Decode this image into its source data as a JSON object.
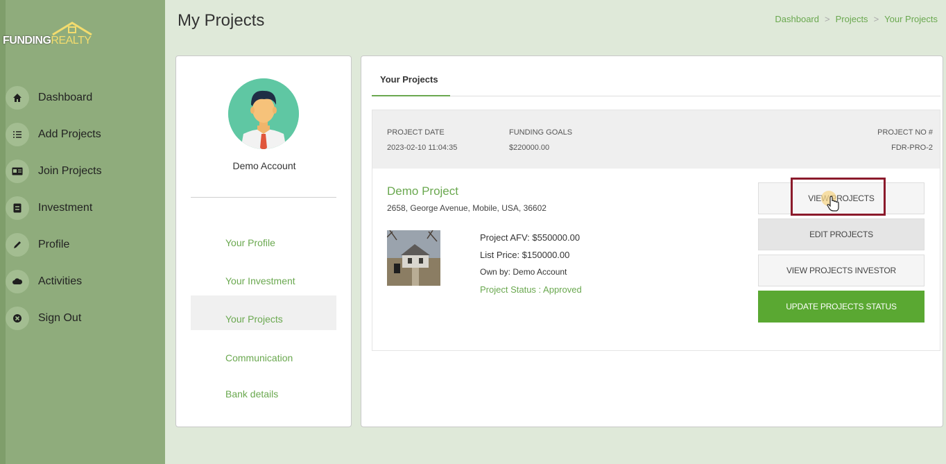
{
  "logo": {
    "word1": "FUNDING",
    "word2": "REALTY"
  },
  "nav": [
    {
      "label": "Dashboard",
      "icon": "home-icon"
    },
    {
      "label": "Add Projects",
      "icon": "list-add-icon"
    },
    {
      "label": "Join Projects",
      "icon": "id-card-icon"
    },
    {
      "label": "Investment",
      "icon": "wallet-icon"
    },
    {
      "label": "Profile",
      "icon": "pencil-icon"
    },
    {
      "label": "Activities",
      "icon": "cloud-icon"
    },
    {
      "label": "Sign Out",
      "icon": "close-circle-icon"
    }
  ],
  "header": {
    "title": "My Projects"
  },
  "breadcrumb": [
    "Dashboard",
    "Projects",
    "Your Projects"
  ],
  "profile": {
    "name": "Demo Account",
    "menu": [
      "Your Profile",
      "Your Investment",
      "Your Projects",
      "Communication",
      "Bank details"
    ],
    "active_menu": "Your Projects"
  },
  "tabs": [
    "Your Projects"
  ],
  "project": {
    "date_label": "PROJECT DATE",
    "date": "2023-02-10 11:04:35",
    "goals_label": "FUNDING GOALS",
    "goals": "$220000.00",
    "no_label": "PROJECT NO #",
    "no": "FDR-PRO-2",
    "name": "Demo Project",
    "address": "2658, George Avenue, Mobile, USA, 36602",
    "afv": "Project AFV: $550000.00",
    "list_price": "List Price: $150000.00",
    "owner": "Own by: Demo Account",
    "status": "Project Status : Approved"
  },
  "buttons": {
    "view": "VIEW PROJECTS",
    "edit": "EDIT PROJECTS",
    "investor": "VIEW PROJECTS INVESTOR",
    "update": "UPDATE PROJECTS STATUS"
  },
  "colors": {
    "accent": "#6aa84f",
    "sidebar": "#8fac7c",
    "highlight": "#8b1a2b",
    "button_green": "#5aa832"
  }
}
